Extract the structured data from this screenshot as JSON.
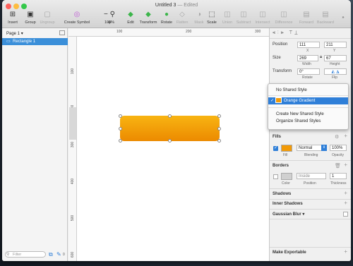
{
  "window": {
    "title": "Untitled 3",
    "edited": "— Edited"
  },
  "toolbar": {
    "insert": "Insert",
    "group": "Group",
    "ungroup": "Ungroup",
    "create_symbol": "Create Symbol",
    "zoom": "100%",
    "edit": "Edit",
    "transform": "Transform",
    "rotate": "Rotate",
    "flatten": "Flatten",
    "mask": "Mask",
    "scale": "Scale",
    "union": "Union",
    "subtract": "Subtract",
    "intersect": "Intersect",
    "difference": "Difference",
    "forward": "Forward",
    "backward": "Backward"
  },
  "sidebar": {
    "page": "Page 1",
    "layer": "Rectangle 1",
    "filter_placeholder": "Filter",
    "count": "0"
  },
  "rulers": {
    "top": [
      "100",
      "200",
      "300"
    ],
    "left": [
      "100",
      "200",
      "300",
      "400",
      "500",
      "600"
    ]
  },
  "inspector": {
    "position_label": "Position",
    "x": "111",
    "y": "211",
    "x_label": "X",
    "y_label": "Y",
    "size_label": "Size",
    "width": "269",
    "height": "67",
    "width_label": "Width",
    "height_label": "Height",
    "transform_label": "Transform",
    "rotate": "0°",
    "rotate_label": "Rotate",
    "flip_label": "Flip",
    "fills": "Fills",
    "blending": "Normal",
    "opacity": "100%",
    "fill_label": "Fill",
    "blending_label": "Blending",
    "opacity_label": "Opacity",
    "borders": "Borders",
    "position": "Inside",
    "thickness": "1",
    "color_label": "Color",
    "position_sub": "Position",
    "thickness_label": "Thickness",
    "shadows": "Shadows",
    "inner_shadows": "Inner Shadows",
    "gaussian_blur": "Gaussian Blur",
    "make_exportable": "Make Exportable"
  },
  "menu": {
    "no_shared": "No Shared Style",
    "orange": "Orange Gradient",
    "create_new": "Create New Shared Style",
    "organize": "Organize Shared Styles"
  },
  "colors": {
    "accent": "#3b8fd9",
    "orange_top": "#f8b412",
    "orange_bottom": "#ec8a00"
  }
}
